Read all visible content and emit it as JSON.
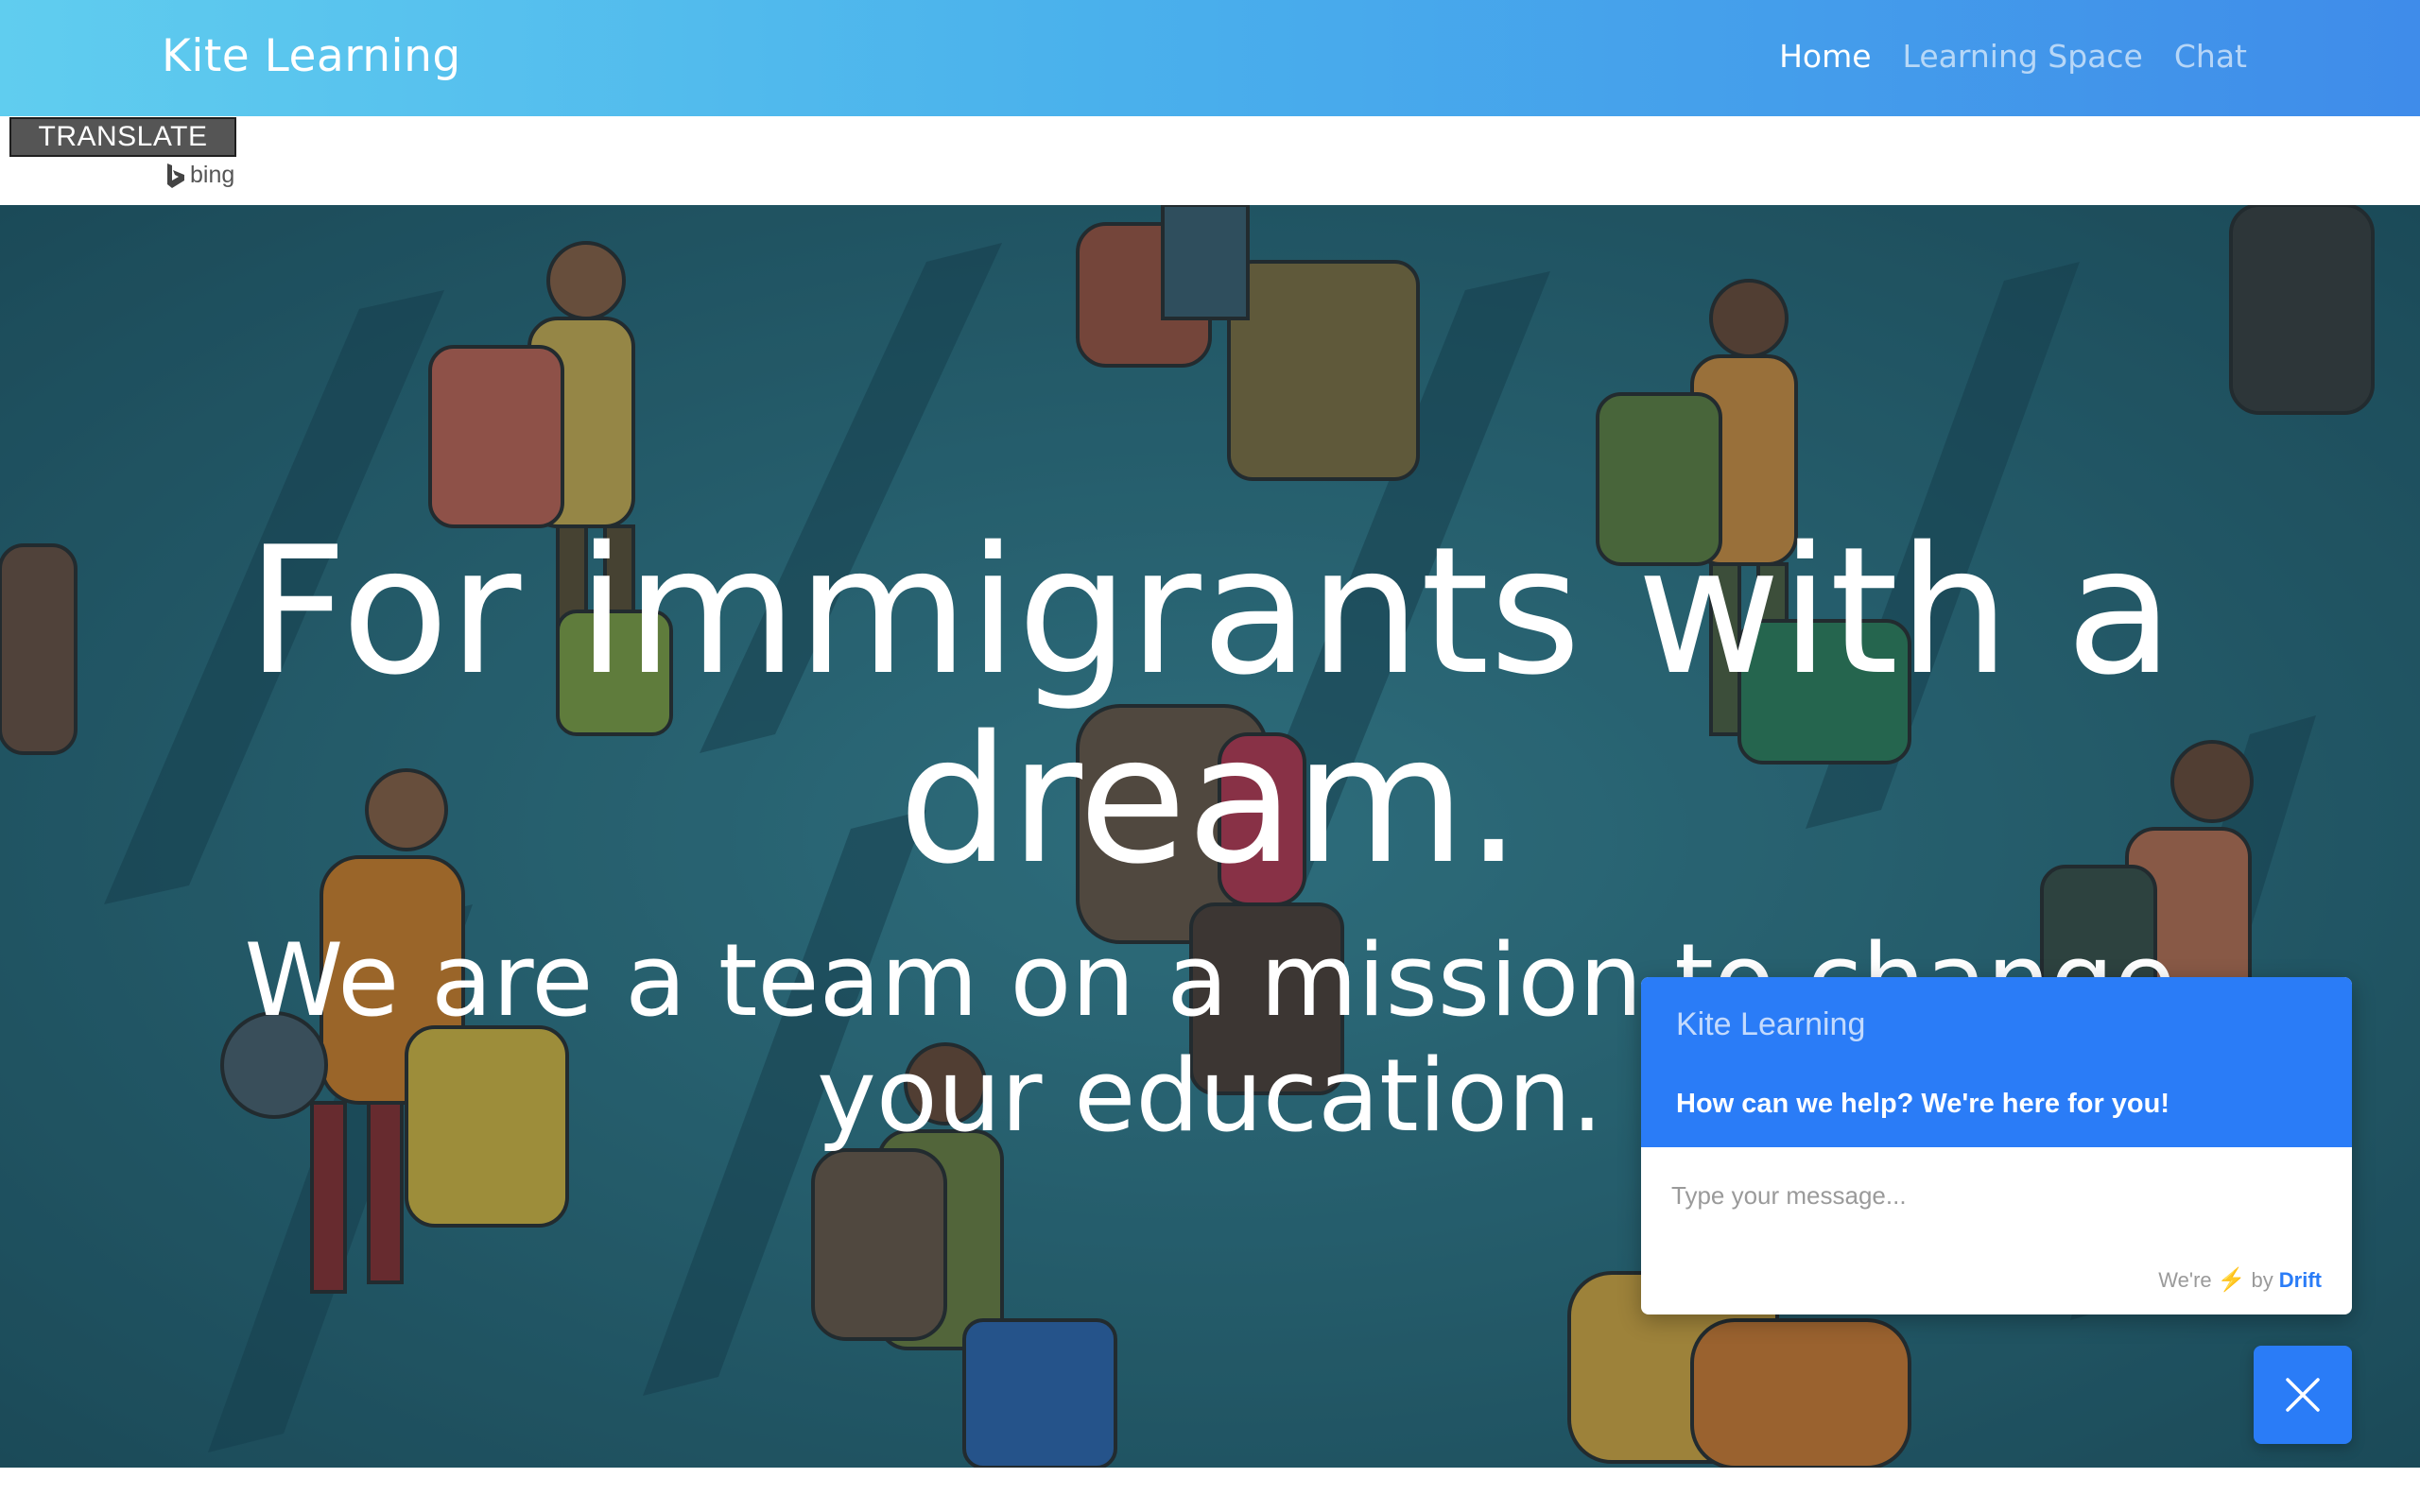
{
  "nav": {
    "brand": "Kite Learning",
    "links": [
      {
        "label": "Home",
        "active": true
      },
      {
        "label": "Learning Space",
        "active": false
      },
      {
        "label": "Chat",
        "active": false
      }
    ]
  },
  "translate": {
    "button_label": "TRANSLATE",
    "provider": "bing",
    "provider_icon": "bing-logo-icon"
  },
  "hero": {
    "title": "For immigrants with a dream.",
    "subtitle": "We are a team on a mission to change your education."
  },
  "chat": {
    "company": "Kite Learning",
    "welcome": "How can we help? We're here for you!",
    "input_placeholder": "Type your message...",
    "powered_prefix": "We're",
    "powered_icon": "lightning-bolt-icon",
    "powered_by": "by",
    "powered_brand": "Drift",
    "close_icon": "close-icon"
  },
  "colors": {
    "nav_gradient_start": "#60cdef",
    "nav_gradient_end": "#3f8cea",
    "chat_accent": "#2a7cf7",
    "translate_button": "#555555",
    "hero_background": "#2f6f7d"
  }
}
